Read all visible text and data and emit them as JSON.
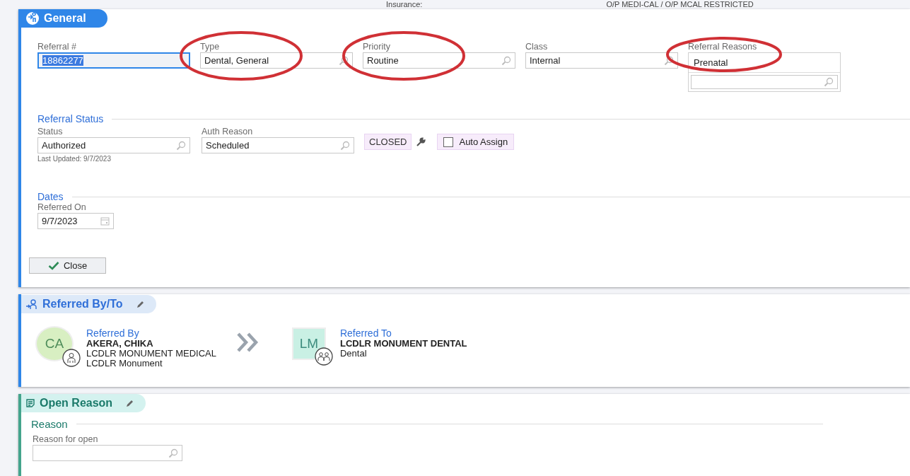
{
  "top_strip": {
    "label": "Insurance:",
    "value": "O/P MEDI-CAL / O/P MCAL RESTRICTED"
  },
  "general": {
    "title": "General",
    "fields": [
      {
        "label": "Referral #",
        "value": "18862277",
        "kind": "text",
        "focused": true,
        "circled": false
      },
      {
        "label": "Type",
        "value": "Dental, General",
        "kind": "lookup",
        "focused": false,
        "circled": true
      },
      {
        "label": "Priority",
        "value": "Routine",
        "kind": "lookup",
        "focused": false,
        "circled": true
      },
      {
        "label": "Class",
        "value": "Internal",
        "kind": "lookup",
        "focused": false,
        "circled": false
      }
    ],
    "referral_reasons": {
      "label": "Referral Reasons",
      "items": [
        "Prenatal"
      ],
      "circled": true
    },
    "status_section": {
      "title": "Referral Status",
      "fields": [
        {
          "label": "Status",
          "value": "Authorized",
          "note": "Last Updated: 9/7/2023"
        },
        {
          "label": "Auth Reason",
          "value": "Scheduled"
        }
      ],
      "badge": "CLOSED",
      "auto_assign": {
        "label": "Auto Assign",
        "checked": false
      }
    },
    "dates_section": {
      "title": "Dates",
      "field": {
        "label": "Referred On",
        "value": "9/7/2023"
      }
    },
    "close_button": "Close"
  },
  "referred": {
    "title": "Referred By/To",
    "by": {
      "heading": "Referred By",
      "initials": "CA",
      "lines": [
        "AKERA, CHIKA",
        "LCDLR MONUMENT MEDICAL",
        "LCDLR Monument"
      ]
    },
    "to": {
      "heading": "Referred To",
      "initials": "LM",
      "lines": [
        "LCDLR MONUMENT DENTAL",
        "Dental"
      ]
    }
  },
  "open_reason": {
    "title": "Open Reason",
    "section": "Reason",
    "field": {
      "label": "Reason for open"
    }
  }
}
